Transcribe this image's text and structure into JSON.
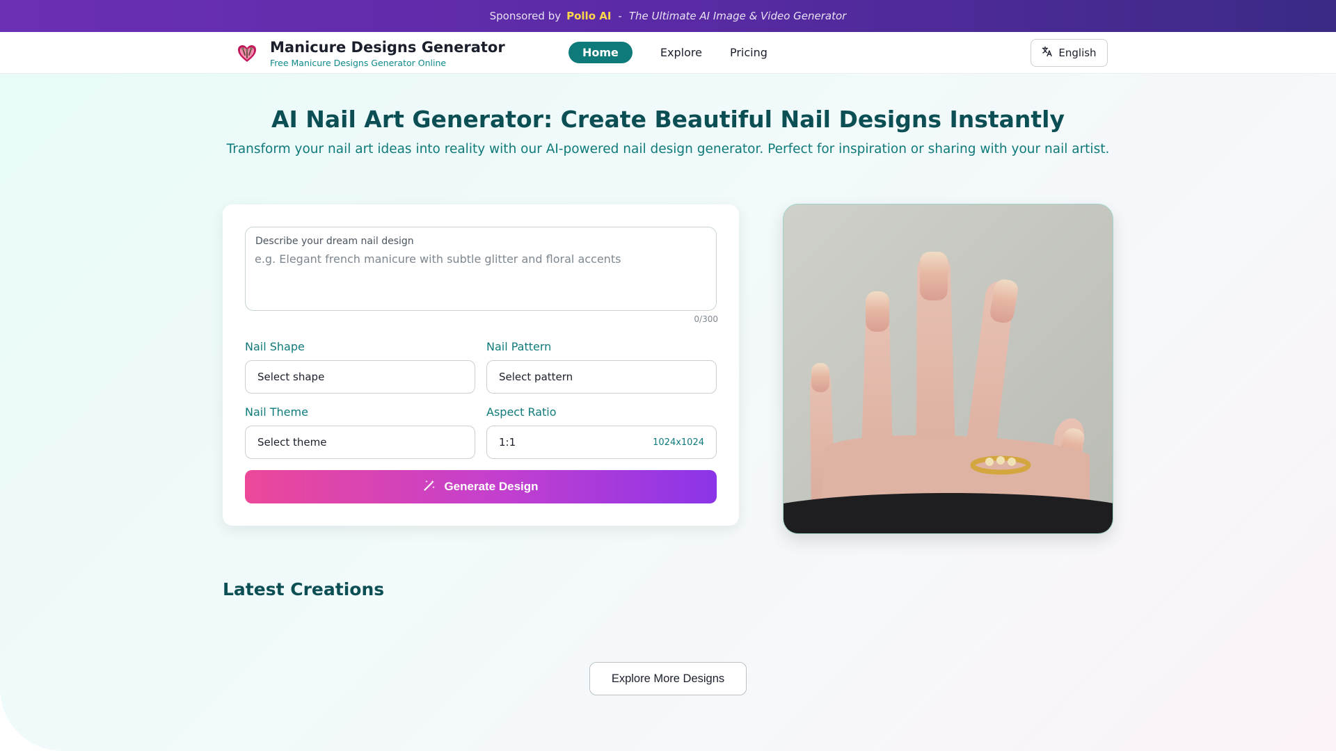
{
  "sponsor": {
    "prefix": "Sponsored by",
    "brand": "Pollo AI",
    "separator": "-",
    "tagline": "The Ultimate AI Image & Video Generator",
    "brand_color": "#ffd54a"
  },
  "header": {
    "logo_icon": "heart-nail-logo-icon",
    "title": "Manicure Designs Generator",
    "subtitle": "Free Manicure Designs Generator Online",
    "nav": {
      "home": "Home",
      "explore": "Explore",
      "pricing": "Pricing"
    },
    "language": {
      "icon": "translate-icon",
      "label": "English"
    }
  },
  "hero": {
    "title": "AI Nail Art Generator: Create Beautiful Nail Designs Instantly",
    "subtitle": "Transform your nail art ideas into reality with our AI-powered nail design generator. Perfect for inspiration or sharing with your nail artist."
  },
  "form": {
    "prompt_label": "Describe your dream nail design",
    "prompt_placeholder": "e.g. Elegant french manicure with subtle glitter and floral accents",
    "prompt_value": "",
    "char_count": "0/300",
    "nail_shape": {
      "label": "Nail Shape",
      "value": "Select shape"
    },
    "nail_pattern": {
      "label": "Nail Pattern",
      "value": "Select pattern"
    },
    "nail_theme": {
      "label": "Nail Theme",
      "value": "Select theme"
    },
    "aspect_ratio": {
      "label": "Aspect Ratio",
      "value": "1:1",
      "size": "1024x1024"
    },
    "generate": {
      "label": "Generate Design",
      "icon": "magic-wand-icon"
    }
  },
  "preview": {
    "alt": "Hand with glitter ombre nails and gold ring"
  },
  "latest": {
    "title": "Latest Creations",
    "explore_button": "Explore More Designs"
  },
  "colors": {
    "accent": "#0f7a7a",
    "heading": "#0b4f55",
    "gradient_start": "#ec4899",
    "gradient_end": "#8b35e8"
  }
}
